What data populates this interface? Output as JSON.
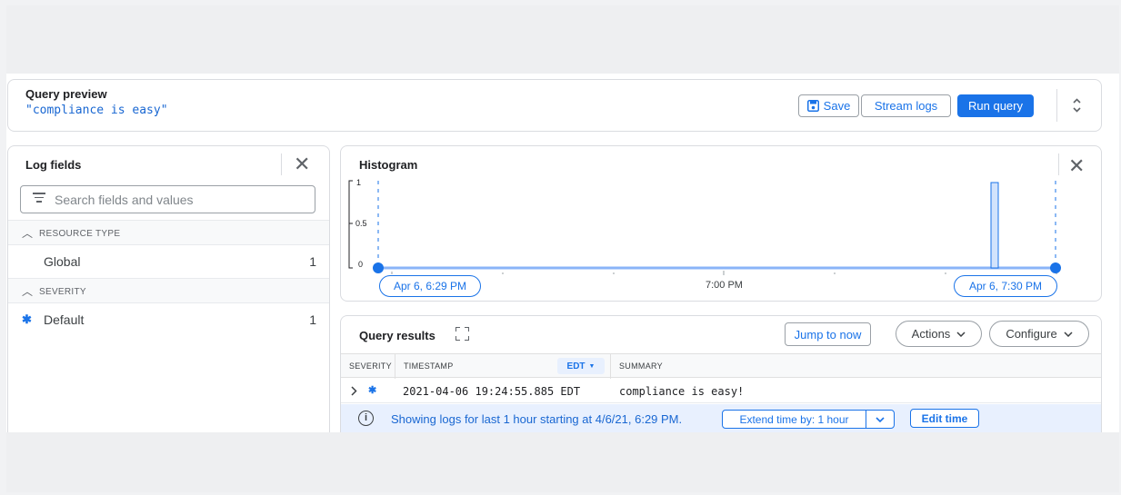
{
  "query_preview": {
    "title": "Query preview",
    "query_text": "\"compliance is easy\"",
    "save_label": "Save",
    "stream_logs_label": "Stream logs",
    "run_query_label": "Run query"
  },
  "log_fields": {
    "title": "Log fields",
    "search_placeholder": "Search fields and values",
    "sections": [
      {
        "header": "RESOURCE TYPE",
        "items": [
          {
            "label": "Global",
            "count": "1"
          }
        ]
      },
      {
        "header": "SEVERITY",
        "items": [
          {
            "label": "Default",
            "count": "1"
          }
        ]
      }
    ]
  },
  "histogram": {
    "title": "Histogram",
    "y_ticks": [
      "1",
      "0.5",
      "0"
    ],
    "start_label": "Apr 6, 6:29 PM",
    "mid_label": "7:00 PM",
    "end_label": "Apr 6, 7:30 PM"
  },
  "chart_data": {
    "type": "bar",
    "title": "Histogram",
    "x": [
      "Apr 6, 6:29 PM",
      "7:00 PM",
      "Apr 6, 7:30 PM"
    ],
    "series": [
      {
        "values": [
          0,
          0,
          1
        ]
      }
    ],
    "ylim": [
      0,
      1
    ]
  },
  "query_results": {
    "title": "Query results",
    "jump_to_now": "Jump to now",
    "actions_label": "Actions",
    "configure_label": "Configure",
    "columns": {
      "severity": "SEVERITY",
      "timestamp": "TIMESTAMP",
      "timezone": "EDT",
      "summary": "SUMMARY"
    },
    "rows": [
      {
        "timestamp": "2021-04-06 19:24:55.885 EDT",
        "summary": "compliance is easy!"
      }
    ],
    "info_text": "Showing logs for last 1 hour starting at 4/6/21, 6:29 PM.",
    "extend_label": "Extend time by: 1 hour",
    "edit_time_label": "Edit time"
  },
  "colors": {
    "accent": "#1a73e8",
    "severity_default": "#1a73e8",
    "info_bg": "#e8f0fe"
  }
}
